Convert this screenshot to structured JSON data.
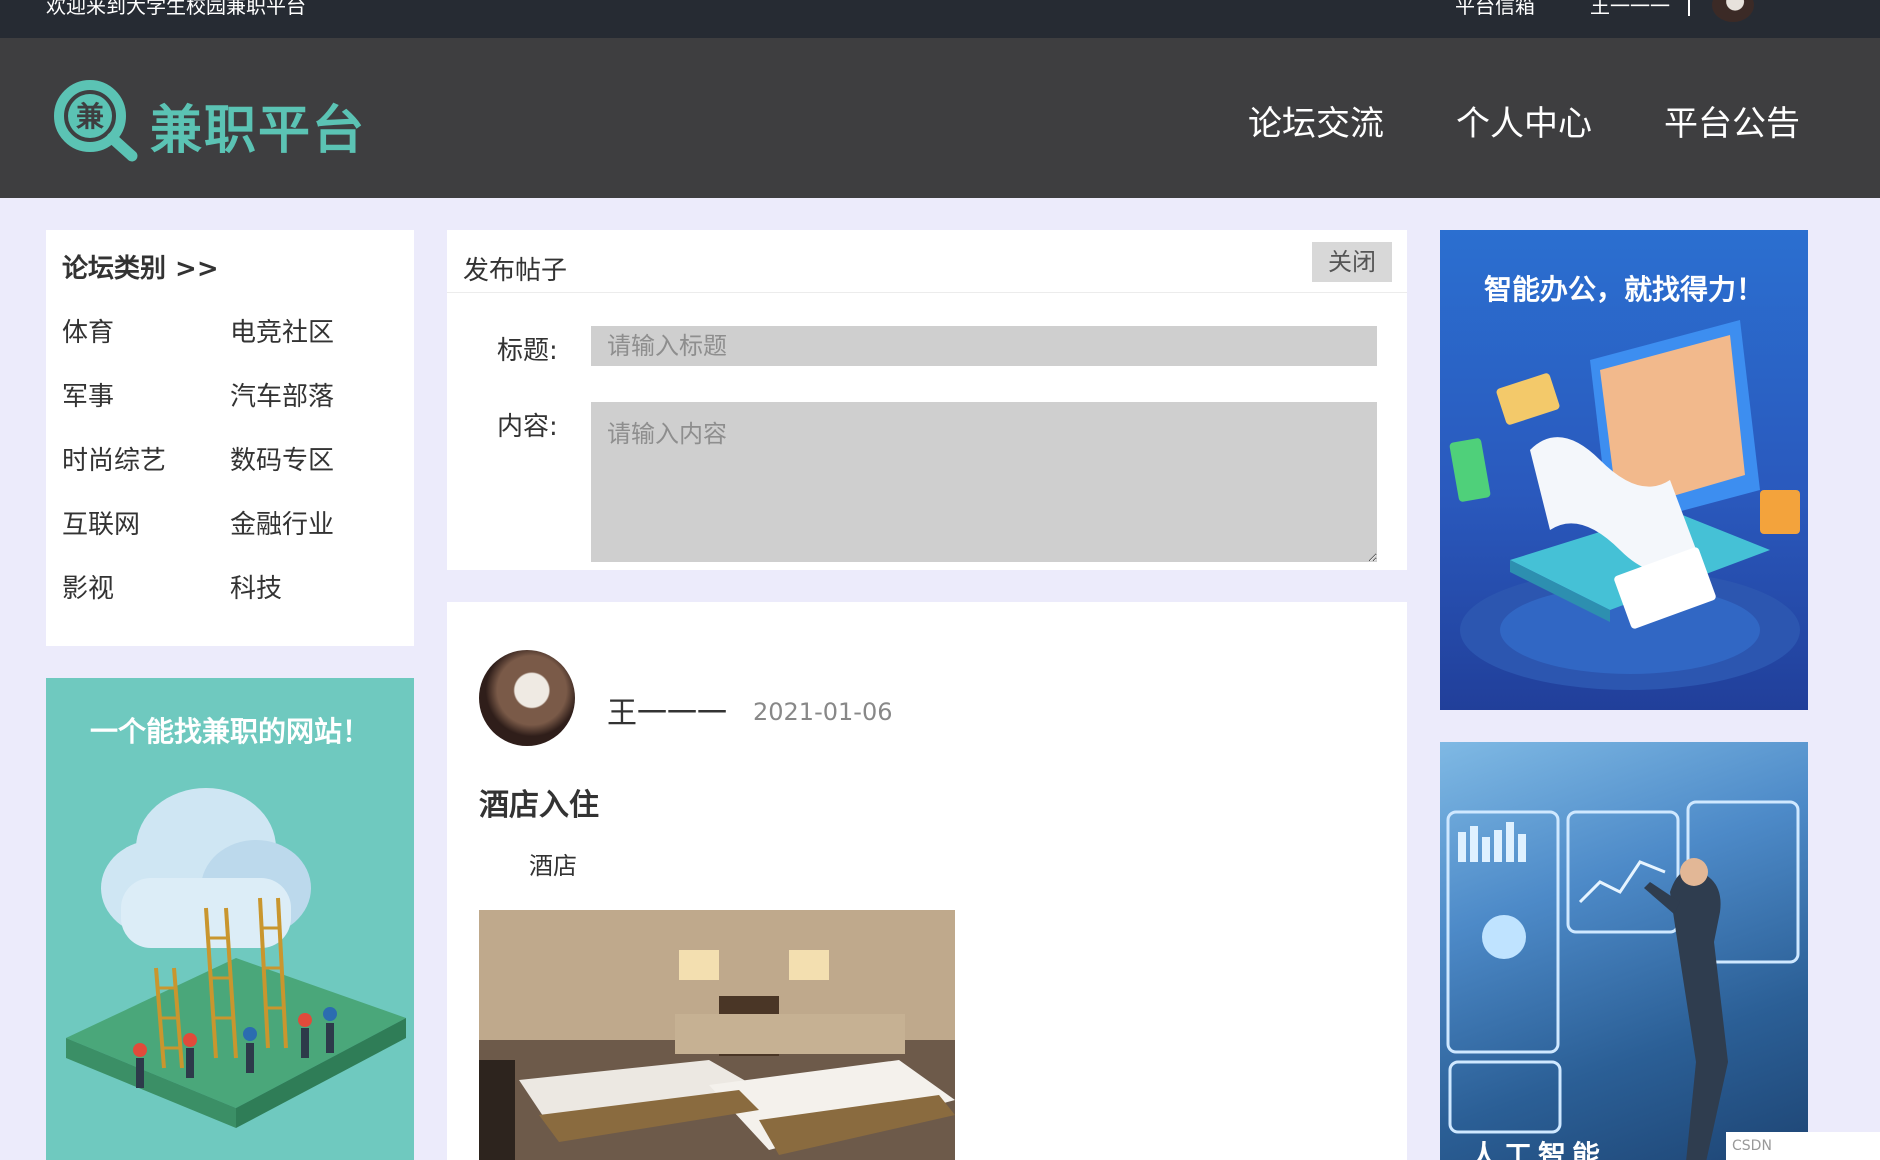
{
  "topbar": {
    "welcome": "欢迎来到大学生校园兼职平台",
    "mailbox": "平台信箱",
    "username": "王一一一"
  },
  "header": {
    "logo_char": "兼",
    "logo_text": "兼职平台",
    "nav": [
      "论坛交流",
      "个人中心",
      "平台公告"
    ]
  },
  "categories": {
    "title": "论坛类别 >>",
    "items": [
      "体育",
      "电竞社区",
      "军事",
      "汽车部落",
      "时尚综艺",
      "数码专区",
      "互联网",
      "金融行业",
      "影视",
      "科技"
    ]
  },
  "left_banner": {
    "slogan": "一个能找兼职的网站！"
  },
  "post_form": {
    "title": "发布帖子",
    "close_label": "关闭",
    "title_label": "标题:",
    "title_placeholder": "请输入标题",
    "content_label": "内容:",
    "content_placeholder": "请输入内容"
  },
  "feed": {
    "author": "王一一一",
    "date": "2021-01-06",
    "post_title": "酒店入住",
    "post_text": "酒店"
  },
  "right_banners": {
    "first_slogan": "智能办公，就找得力！",
    "second_caption": "人工智能"
  },
  "footer_tag": "CSDN",
  "colors": {
    "accent": "#5bc3b4",
    "header_bg": "#3e3e40",
    "topbar_bg": "#262b33",
    "page_bg": "#ecebfb"
  }
}
